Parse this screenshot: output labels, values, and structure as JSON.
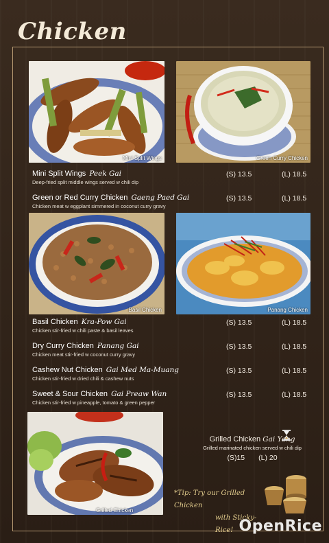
{
  "menu": {
    "title": "Chicken",
    "photos": [
      {
        "caption": "Mini Split Wings"
      },
      {
        "caption": "Green Curry Chicken"
      },
      {
        "caption": "Basil Chicken"
      },
      {
        "caption": "Panang Chicken"
      },
      {
        "caption": "Grilled Chicken"
      }
    ],
    "items": [
      {
        "name": "Mini Split Wings",
        "thai": "Peek Gai",
        "desc": "Deep-fried split middle wings served w chili dip",
        "small": "(S) 13.5",
        "large": "(L) 18.5"
      },
      {
        "name": "Green or Red Curry Chicken",
        "thai": "Gaeng Paed Gai",
        "desc": "Chicken meat w eggplant simmered in coconut curry gravy",
        "small": "(S) 13.5",
        "large": "(L) 18.5"
      },
      {
        "name": "Basil Chicken",
        "thai": "Kra-Pow Gai",
        "desc": "Chicken stir-fried w chili paste & basil leaves",
        "small": "(S) 13.5",
        "large": "(L) 18.5"
      },
      {
        "name": "Dry Curry Chicken",
        "thai": "Panang Gai",
        "desc": "Chicken meat stir-fried w coconut curry gravy",
        "small": "(S) 13.5",
        "large": "(L) 18.5"
      },
      {
        "name": "Cashew Nut Chicken",
        "thai": "Gai Med Ma-Muang",
        "desc": "Chicken stir-fried w dried chili & cashew nuts",
        "small": "(S) 13.5",
        "large": "(L) 18.5"
      },
      {
        "name": "Sweet & Sour Chicken",
        "thai": "Gai Preaw Wan",
        "desc": "Chicken stir-fried w pineapple, tomato & green pepper",
        "small": "(S) 13.5",
        "large": "(L) 18.5"
      }
    ],
    "grilled": {
      "name": "Grilled Chicken",
      "thai": "Gai Yang",
      "desc": "Grilled marinated chicken served w chili dip",
      "small": "(S)15",
      "large": "(L) 20"
    },
    "tip": {
      "line1": "*Tip: Try our Grilled Chicken",
      "line2": "with Sticky-Rice!"
    },
    "watermark": "OpenRice"
  }
}
